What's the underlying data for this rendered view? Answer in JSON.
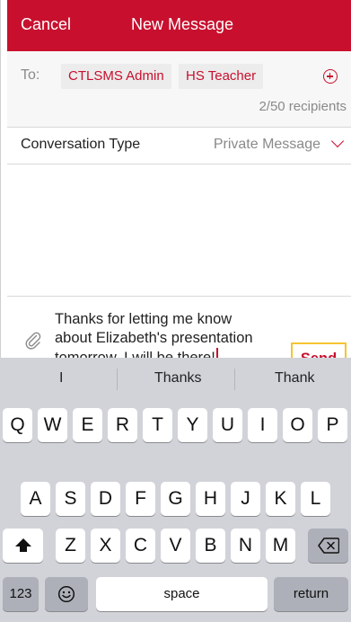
{
  "header": {
    "cancel_label": "Cancel",
    "title": "New Message",
    "background_color": "#c8102e"
  },
  "recipients": {
    "to_label": "To:",
    "chips": [
      "CTLSMS Admin",
      "HS Teacher"
    ],
    "add_icon": "plus-circle-icon",
    "count_text": "2/50 recipients"
  },
  "conversation": {
    "label": "Conversation Type",
    "value": "Private Message",
    "dropdown_icon": "chevron-down-icon"
  },
  "compose": {
    "attach_icon": "paperclip-icon",
    "message_lines": [
      "Thanks for letting me know",
      "about Elizabeth's presentation",
      "tomorrow. I will be there!"
    ],
    "send_label": "Send",
    "highlight_color": "#f5c431"
  },
  "keyboard": {
    "suggestions": [
      "I",
      "Thanks",
      "Thank"
    ],
    "row1": [
      "Q",
      "W",
      "E",
      "R",
      "T",
      "Y",
      "U",
      "I",
      "O",
      "P"
    ],
    "row2": [
      "A",
      "S",
      "D",
      "F",
      "G",
      "H",
      "J",
      "K",
      "L"
    ],
    "row3": [
      "Z",
      "X",
      "C",
      "V",
      "B",
      "N",
      "M"
    ],
    "shift_icon": "shift-icon",
    "backspace_icon": "backspace-icon",
    "numbers_label": "123",
    "emoji_icon": "emoji-icon",
    "space_label": "space",
    "return_label": "return"
  }
}
